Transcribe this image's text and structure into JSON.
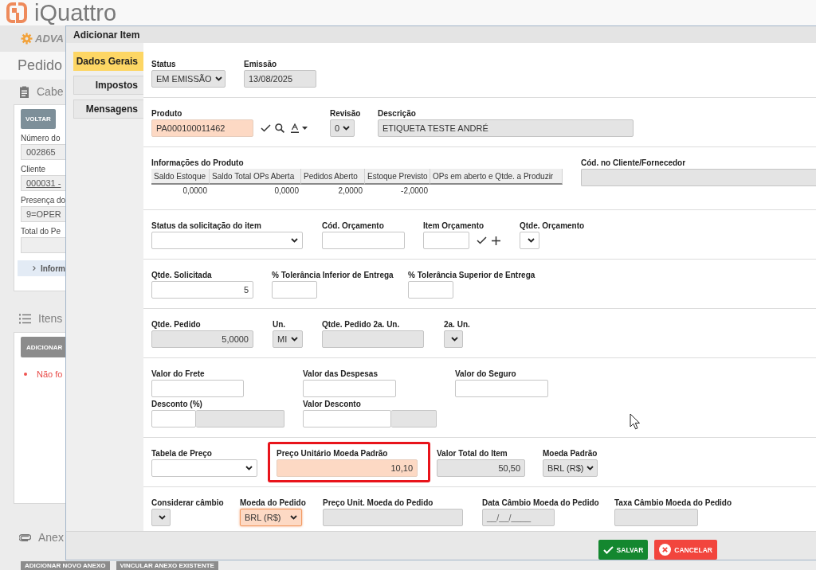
{
  "header": {
    "logo_text": "iQuattro"
  },
  "menu_bar": {
    "brand": "ADVA"
  },
  "page": {
    "title": "Pedido",
    "sections": [
      {
        "kind": "header",
        "title": "Cabe",
        "buttons": [
          {
            "label": "VOLTAR",
            "disabled": false
          }
        ],
        "fields": [
          {
            "label": "Número do",
            "value": "002865",
            "link": false
          },
          {
            "label": "Cliente",
            "value": "000031 -",
            "link": true
          },
          {
            "label": "Presença do",
            "value": "9=OPER",
            "link": false
          },
          {
            "label": "Total do Pe"
          }
        ],
        "expander": {
          "label": "Inform",
          "expanded": false
        }
      },
      {
        "kind": "items",
        "title": "Itens",
        "buttons": [
          {
            "label": "ADICIONAR",
            "disabled": true
          }
        ],
        "messages": [
          "Não fo"
        ]
      },
      {
        "kind": "attachments",
        "title": "Anex",
        "buttons": [
          {
            "label": "ADICIONAR NOVO ANEXO",
            "disabled": true
          },
          {
            "label": "VINCULAR ANEXO EXISTENTE",
            "disabled": true
          }
        ]
      }
    ]
  },
  "dialog": {
    "title": "Adicionar Item",
    "tabs": [
      {
        "label": "Dados Gerais",
        "selected": true
      },
      {
        "label": "Impostos",
        "selected": false
      },
      {
        "label": "Mensagens",
        "selected": false
      }
    ],
    "sections": [
      {
        "rows": [
          [
            {
              "kind": "select",
              "label": "Status",
              "value": "EM EMISSÃO",
              "disabled": true,
              "highlighted": false,
              "focused": false
            },
            {
              "kind": "text",
              "label": "Emissão",
              "value": "13/08/2025",
              "disabled": true,
              "highlighted": false,
              "focused": false
            }
          ]
        ]
      },
      {
        "rows": [
          [
            {
              "kind": "lookup",
              "label": "Produto",
              "value": "PA000100011462",
              "disabled": false,
              "highlighted": true,
              "focused": false
            },
            {
              "kind": "select",
              "label": "Revisão",
              "value": "0",
              "disabled": true,
              "highlighted": false,
              "focused": false
            },
            {
              "kind": "text",
              "label": "Descrição",
              "value": "ETIQUETA TESTE ANDRÉ",
              "disabled": true,
              "highlighted": false,
              "focused": false
            }
          ]
        ]
      },
      {
        "rows": [
          [
            {
              "kind": "table",
              "label": "Informações do Produto",
              "columns": [
                "Saldo Estoque",
                "Saldo Total OPs Aberta",
                "Pedidos Aberto",
                "Estoque Previsto",
                "OPs em aberto e Qtde. a Produzir"
              ],
              "rows": [
                [
                  "0,0000",
                  "0,0000",
                  "2,0000",
                  "-2,0000"
                ]
              ]
            },
            {
              "kind": "text",
              "label": "Cód. no Cliente/Fornecedor",
              "disabled": true,
              "highlighted": false,
              "focused": false
            }
          ]
        ]
      },
      {
        "rows": [
          [
            {
              "kind": "select",
              "label": "Status da solicitação do item",
              "disabled": false,
              "highlighted": false,
              "focused": false
            },
            {
              "kind": "text",
              "label": "Cód. Orçamento",
              "disabled": false,
              "highlighted": false,
              "focused": false
            },
            {
              "kind": "linked",
              "label": "Item Orçamento",
              "disabled": false,
              "highlighted": false,
              "focused": false
            },
            {
              "kind": "select",
              "label": "Qtde. Orçamento",
              "disabled": false,
              "highlighted": false,
              "focused": false
            }
          ]
        ]
      },
      {
        "rows": [
          [
            {
              "kind": "number",
              "label": "Qtde. Solicitada",
              "value": "5",
              "disabled": false,
              "highlighted": false,
              "focused": false
            },
            {
              "kind": "number",
              "label": "% Tolerância Inferior de Entrega",
              "disabled": false,
              "highlighted": false,
              "focused": false
            },
            {
              "kind": "number",
              "label": "% Tolerância Superior de Entrega",
              "disabled": false,
              "highlighted": false,
              "focused": false
            }
          ]
        ]
      },
      {
        "rows": [
          [
            {
              "kind": "number",
              "label": "Qtde. Pedido",
              "value": "5,0000",
              "disabled": true,
              "highlighted": false,
              "focused": false
            },
            {
              "kind": "select",
              "label": "Un.",
              "value": "MI",
              "disabled": true,
              "highlighted": false,
              "focused": false
            },
            {
              "kind": "number",
              "label": "Qtde. Pedido 2a. Un.",
              "disabled": true,
              "highlighted": false,
              "focused": false
            },
            {
              "kind": "select",
              "label": "2a. Un.",
              "disabled": true,
              "highlighted": false,
              "focused": false
            }
          ]
        ]
      },
      {
        "rows": [
          [
            {
              "kind": "number",
              "label": "Valor do Frete",
              "disabled": false,
              "highlighted": false,
              "focused": false
            },
            {
              "kind": "number",
              "label": "Valor das Despesas",
              "disabled": false,
              "highlighted": false,
              "focused": false
            },
            {
              "kind": "number",
              "label": "Valor do Seguro",
              "disabled": false,
              "highlighted": false,
              "focused": false
            }
          ],
          [
            {
              "kind": "pair",
              "label": "Desconto (%)",
              "parts": [
                {
                  "disabled": false
                },
                {
                  "disabled": true
                }
              ]
            },
            {
              "kind": "pair",
              "label": "Valor Desconto",
              "parts": [
                {
                  "disabled": false
                },
                {
                  "disabled": true
                }
              ]
            }
          ]
        ]
      },
      {
        "rows": [
          [
            {
              "kind": "select",
              "label": "Tabela de Preço",
              "disabled": false,
              "highlighted": false,
              "focused": false
            },
            {
              "kind": "number",
              "label": "Preço Unitário Moeda Padrão",
              "value": "10,10",
              "disabled": false,
              "highlighted": true,
              "focused": false,
              "marked": true
            },
            {
              "kind": "number",
              "label": "Valor Total do Item",
              "value": "50,50",
              "disabled": true,
              "highlighted": false,
              "focused": false
            },
            {
              "kind": "select",
              "label": "Moeda Padrão",
              "value": "BRL (R$)",
              "disabled": true,
              "highlighted": false,
              "focused": false
            }
          ]
        ]
      },
      {
        "rows": [
          [
            {
              "kind": "select",
              "label": "Considerar câmbio",
              "disabled": true,
              "highlighted": false,
              "focused": false
            },
            {
              "kind": "select",
              "label": "Moeda do Pedido",
              "value": "BRL (R$)",
              "disabled": false,
              "highlighted": true,
              "focused": true
            },
            {
              "kind": "number",
              "label": "Preço Unit. Moeda do Pedido",
              "disabled": true,
              "highlighted": false,
              "focused": false
            },
            {
              "kind": "date",
              "label": "Data Câmbio Moeda do Pedido",
              "placeholder": "__/__/____",
              "disabled": true,
              "highlighted": false,
              "focused": false
            },
            {
              "kind": "number",
              "label": "Taxa Câmbio Moeda do Pedido",
              "disabled": true,
              "highlighted": false,
              "focused": false
            }
          ]
        ]
      }
    ],
    "buttons": [
      {
        "label": "SALVAR",
        "kind": "confirm"
      },
      {
        "label": "CANCELAR",
        "kind": "cancel"
      }
    ]
  }
}
